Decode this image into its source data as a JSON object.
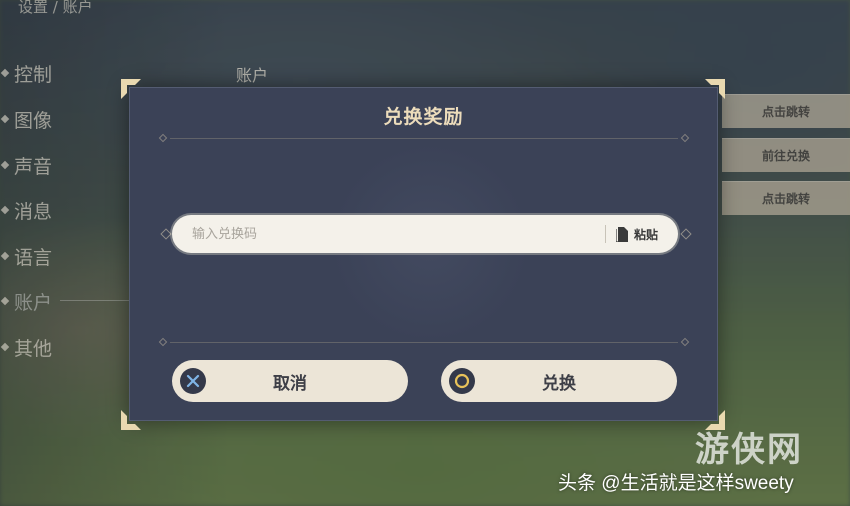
{
  "breadcrumb": "设置 / 账户",
  "sidebar": {
    "items": [
      {
        "label": "控制"
      },
      {
        "label": "图像"
      },
      {
        "label": "声音"
      },
      {
        "label": "消息"
      },
      {
        "label": "语言"
      },
      {
        "label": "账户"
      },
      {
        "label": "其他"
      }
    ]
  },
  "section": {
    "title": "账户"
  },
  "right_buttons": [
    {
      "label": "点击跳转"
    },
    {
      "label": "前往兑换"
    },
    {
      "label": "点击跳转"
    }
  ],
  "dialog": {
    "title": "兑换奖励",
    "input": {
      "placeholder": "输入兑换码",
      "value": ""
    },
    "paste_label": "粘贴",
    "cancel_label": "取消",
    "confirm_label": "兑换"
  },
  "watermarks": {
    "site": "游侠网",
    "source": "头条 @生活就是这样sweety"
  },
  "colors": {
    "dialog_bg": "#3b4257",
    "title_gold": "#ecdcbb",
    "button_bg": "#ece5d7",
    "input_bg": "#f4f1ea"
  }
}
